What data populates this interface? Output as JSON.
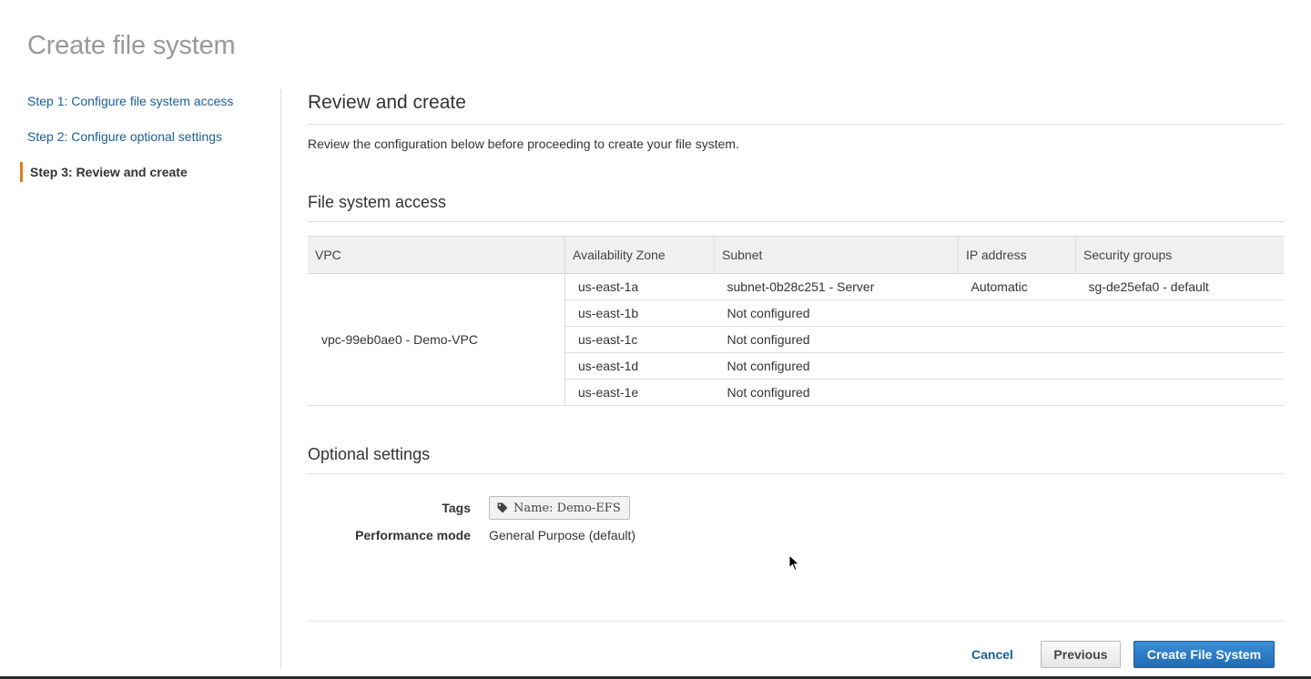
{
  "page": {
    "title": "Create file system"
  },
  "sidebar": {
    "steps": [
      {
        "label": "Step 1: Configure file system access"
      },
      {
        "label": "Step 2: Configure optional settings"
      },
      {
        "label": "Step 3: Review and create"
      }
    ],
    "active_color": "#e07b1a",
    "link_color": "#1a5d9a"
  },
  "main": {
    "heading": "Review and create",
    "description": "Review the configuration below before proceeding to create your file system.",
    "access": {
      "heading": "File system access",
      "columns": [
        "VPC",
        "Availability Zone",
        "Subnet",
        "IP address",
        "Security groups"
      ],
      "vpc": "vpc-99eb0ae0 - Demo-VPC",
      "rows": [
        {
          "az": "us-east-1a",
          "subnet": "subnet-0b28c251 - Server",
          "ip": "Automatic",
          "sg": "sg-de25efa0 - default"
        },
        {
          "az": "us-east-1b",
          "subnet": "Not configured",
          "ip": "",
          "sg": ""
        },
        {
          "az": "us-east-1c",
          "subnet": "Not configured",
          "ip": "",
          "sg": ""
        },
        {
          "az": "us-east-1d",
          "subnet": "Not configured",
          "ip": "",
          "sg": ""
        },
        {
          "az": "us-east-1e",
          "subnet": "Not configured",
          "ip": "",
          "sg": ""
        }
      ]
    },
    "optional": {
      "heading": "Optional settings",
      "tags_label": "Tags",
      "tag_value": "Name: Demo-EFS",
      "tag_icon": "tag-icon",
      "performance_label": "Performance mode",
      "performance_value": "General Purpose (default)"
    }
  },
  "footer": {
    "cancel": "Cancel",
    "previous": "Previous",
    "create": "Create File System",
    "primary_color": "#1f6cb4"
  }
}
